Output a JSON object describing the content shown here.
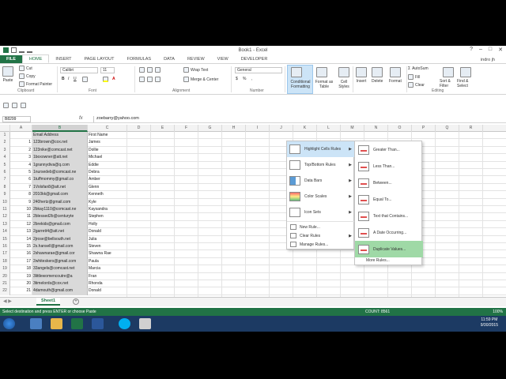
{
  "window": {
    "title": "Book1 - Excel",
    "user": "indro jh",
    "controls": [
      "?",
      "–",
      "□",
      "✕"
    ]
  },
  "tabs": [
    "FILE",
    "HOME",
    "INSERT",
    "PAGE LAYOUT",
    "FORMULAS",
    "DATA",
    "REVIEW",
    "VIEW",
    "DEVELOPER"
  ],
  "ribbon": {
    "clipboard": {
      "paste": "Paste",
      "cut": "Cut",
      "copy": "Copy",
      "format_painter": "Format Painter",
      "label": "Clipboard"
    },
    "font": {
      "name": "Calibri",
      "size": "11",
      "label": "Font"
    },
    "alignment": {
      "wrap": "Wrap Text",
      "merge": "Merge & Center",
      "label": "Alignment"
    },
    "number": {
      "format": "General",
      "label": "Number"
    },
    "styles": {
      "conditional": "Conditional Formatting",
      "format_table": "Format as Table",
      "cell_styles": "Cell Styles"
    },
    "cells": {
      "insert": "Insert",
      "delete": "Delete",
      "format": "Format"
    },
    "editing": {
      "autosum": "AutoSum",
      "fill": "Fill",
      "clear": "Clear",
      "sort": "Sort & Filter",
      "find": "Find & Select",
      "label": "Editing"
    }
  },
  "formula_bar": {
    "namebox": "B8299",
    "fx": "fx",
    "value": "zoebarry@yahoo.com"
  },
  "columns": [
    "A",
    "B",
    "C",
    "D",
    "E",
    "F",
    "G",
    "H",
    "I",
    "J",
    "K",
    "L",
    "M",
    "N",
    "O",
    "P",
    "Q",
    "R"
  ],
  "rows": [
    {
      "n": "1",
      "a": "",
      "b": "Email Address",
      "c": "First Name"
    },
    {
      "n": "2",
      "a": "1",
      "b": "123brown@cox.net",
      "c": "James"
    },
    {
      "n": "3",
      "a": "2",
      "b": "123nike@comcast.net",
      "c": "Dollie"
    },
    {
      "n": "4",
      "a": "3",
      "b": "1boxowner@att.net",
      "c": "Michael"
    },
    {
      "n": "5",
      "a": "4",
      "b": "1grannydiva@q.com",
      "c": "Eddie"
    },
    {
      "n": "6",
      "a": "5",
      "b": "1nursedeb@comcast.ne",
      "c": "Debra"
    },
    {
      "n": "7",
      "a": "6",
      "b": "1tuffmommy@gmail.co",
      "c": "Amber"
    },
    {
      "n": "8",
      "a": "7",
      "b": "1Volsfan8@att.net",
      "c": "Glenn"
    },
    {
      "n": "9",
      "a": "8",
      "b": "2010kk@gmail.com",
      "c": "Kenneth"
    },
    {
      "n": "10",
      "a": "9",
      "b": "240hertz@gmail.com",
      "c": "Kyle"
    },
    {
      "n": "11",
      "a": "10",
      "b": "2bkay1110@comcast.ne",
      "c": "Kaysandra"
    },
    {
      "n": "12",
      "a": "11",
      "b": "2blessed2b@centuryte",
      "c": "Stephen"
    },
    {
      "n": "13",
      "a": "12",
      "b": "2brekids@gmail.com",
      "c": "Holly"
    },
    {
      "n": "14",
      "a": "13",
      "b": "2garrett4@att.net",
      "c": "Donald"
    },
    {
      "n": "15",
      "a": "14",
      "b": "2jrose@bellsouth.net",
      "c": "Julia"
    },
    {
      "n": "16",
      "a": "15",
      "b": "2s.hansell@gmail.com",
      "c": "Steven"
    },
    {
      "n": "17",
      "a": "16",
      "b": "2shawnarae@gmail.cor",
      "c": "Shawna Rae"
    },
    {
      "n": "18",
      "a": "17",
      "b": "2whiteskers@gmail.com",
      "c": "Paula"
    },
    {
      "n": "19",
      "a": "18",
      "b": "33angels@comcast.net",
      "c": "Marcia"
    },
    {
      "n": "20",
      "a": "19",
      "b": "3littlewomencoutre@a",
      "c": "Fran"
    },
    {
      "n": "21",
      "a": "20",
      "b": "3timelords@cox.net",
      "c": "Rhonda"
    },
    {
      "n": "22",
      "a": "21",
      "b": "4damouth@gmail.com",
      "c": "Donald"
    }
  ],
  "sheet": {
    "name": "Sheet1",
    "add": "+"
  },
  "status": {
    "message": "Select destination and press ENTER or choose Paste",
    "count": "COUNT: 8561",
    "zoom": "100%"
  },
  "clock": {
    "time": "11:59 PM",
    "date": "9/30/2015"
  },
  "cf_menu": {
    "items": [
      "Highlight Cells Rules",
      "Top/Bottom Rules",
      "Data Bars",
      "Color Scales",
      "Icon Sets"
    ],
    "small": [
      "New Rule...",
      "Clear Rules",
      "Manage Rules..."
    ]
  },
  "submenu": {
    "items": [
      "Greater Than...",
      "Less Than...",
      "Between...",
      "Equal To...",
      "Text that Contains...",
      "A Date Occurring...",
      "Duplicate Values..."
    ],
    "more": "More Rules..."
  },
  "colors": {
    "excel_green": "#217346",
    "highlight_blue": "#cce4f7",
    "highlight_green": "#9fd9a6"
  }
}
